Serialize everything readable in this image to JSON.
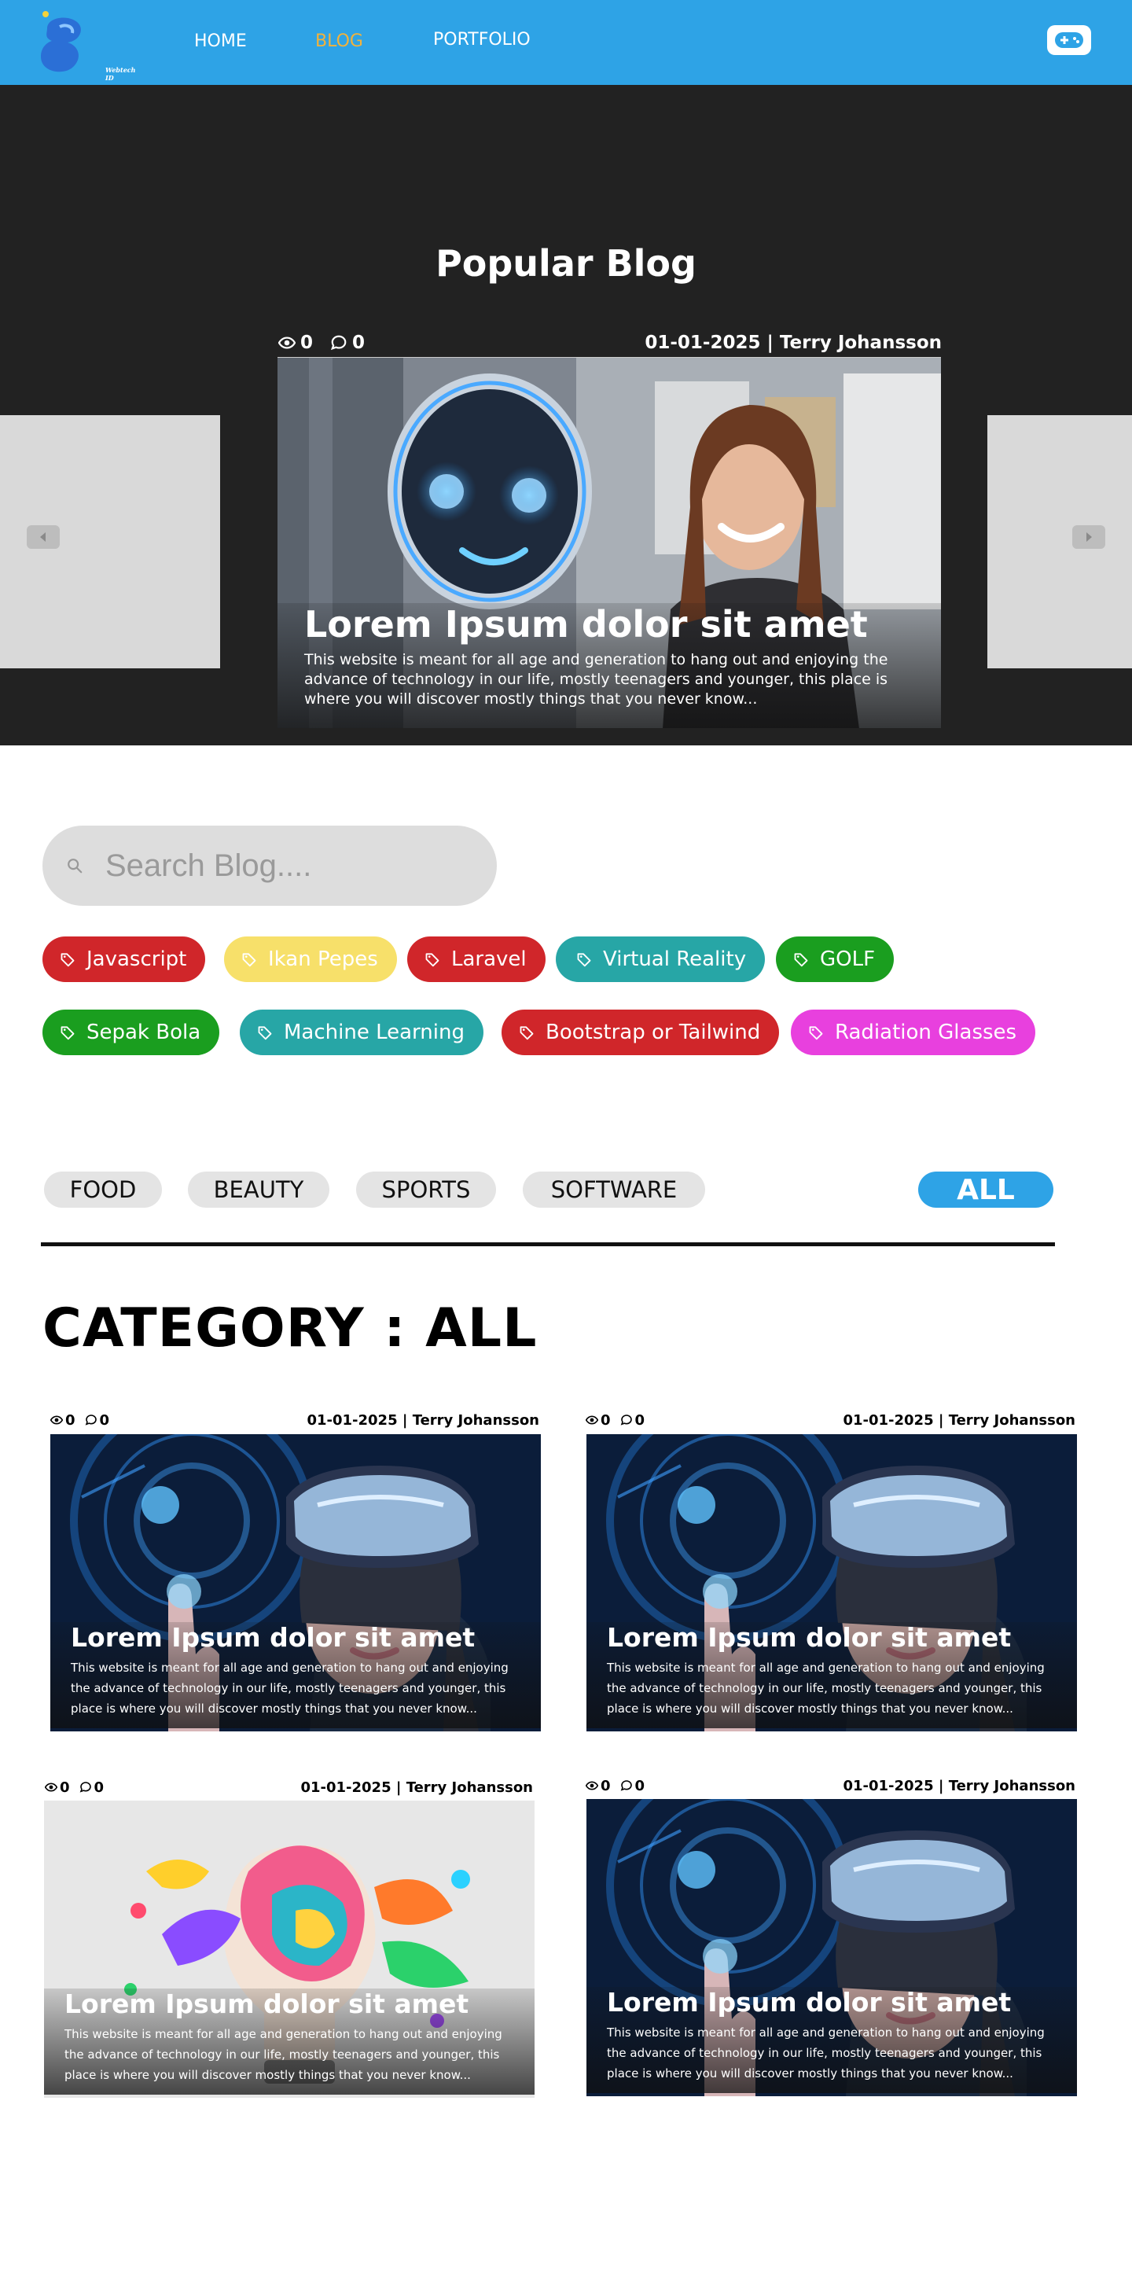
{
  "nav": {
    "logo_text": "Webtech ID",
    "links": [
      "HOME",
      "BLOG",
      "PORTFOLIO"
    ],
    "active": "BLOG"
  },
  "hero": {
    "title": "Popular Blog",
    "views": "0",
    "comments": "0",
    "date_author": "01-01-2025 | Terry Johansson",
    "card_title": "Lorem Ipsum dolor sit amet",
    "card_desc": "This website is meant for all age and generation to hang out and enjoying the advance of technology in our life, mostly teenagers and younger, this place is where you will discover mostly things that you never know..."
  },
  "search": {
    "placeholder": "Search Blog...."
  },
  "tags": [
    {
      "label": "Javascript",
      "color": "#d0262a"
    },
    {
      "label": "Ikan Pepes",
      "color": "#f7e06a"
    },
    {
      "label": "Laravel",
      "color": "#d0262a"
    },
    {
      "label": "Virtual Reality",
      "color": "#27a6a6"
    },
    {
      "label": "GOLF",
      "color": "#1a9e1f"
    },
    {
      "label": "Sepak Bola",
      "color": "#1a9e1f"
    },
    {
      "label": "Machine Learning",
      "color": "#27a6a6"
    },
    {
      "label": "Bootstrap or Tailwind",
      "color": "#d0262a"
    },
    {
      "label": "Radiation Glasses",
      "color": "#e840de"
    }
  ],
  "categories": {
    "tabs": [
      "FOOD",
      "BEAUTY",
      "SPORTS",
      "SOFTWARE",
      "ALL"
    ],
    "active": "ALL",
    "heading": "CATEGORY : ALL"
  },
  "posts": [
    {
      "views": "0",
      "comments": "0",
      "date_author": "01-01-2025 | Terry Johansson",
      "title": "Lorem Ipsum dolor sit amet",
      "desc": "This website is meant for all age and generation to hang out and enjoying the advance of technology in our life, mostly teenagers and younger, this place is where you will discover mostly things that you never know...",
      "image": "vr-headset-woman"
    },
    {
      "views": "0",
      "comments": "0",
      "date_author": "01-01-2025 | Terry Johansson",
      "title": "Lorem Ipsum dolor sit amet",
      "desc": "This website is meant for all age and generation to hang out and enjoying the advance of technology in our life, mostly teenagers and younger, this place is where you will discover mostly things that you never know...",
      "image": "vr-headset-woman"
    },
    {
      "views": "0",
      "comments": "0",
      "date_author": "01-01-2025 | Terry Johansson",
      "title": "Lorem Ipsum dolor sit amet",
      "desc": "This website is meant for all age and generation to hang out and enjoying the advance of technology in our life, mostly teenagers and younger, this place is where you will discover mostly things that you never know...",
      "image": "colorful-lightbulb"
    },
    {
      "views": "0",
      "comments": "0",
      "date_author": "01-01-2025 | Terry Johansson",
      "title": "Lorem Ipsum dolor sit amet",
      "desc": "This website is meant for all age and generation to hang out and enjoying the advance of technology in our life, mostly teenagers and younger, this place is where you will discover mostly things that you never know...",
      "image": "vr-headset-woman"
    }
  ],
  "colors": {
    "nav_bg": "#2ea3e6",
    "active_link": "#f2b23b",
    "hero_bg": "#222222",
    "tab_active": "#2ea3e6"
  }
}
